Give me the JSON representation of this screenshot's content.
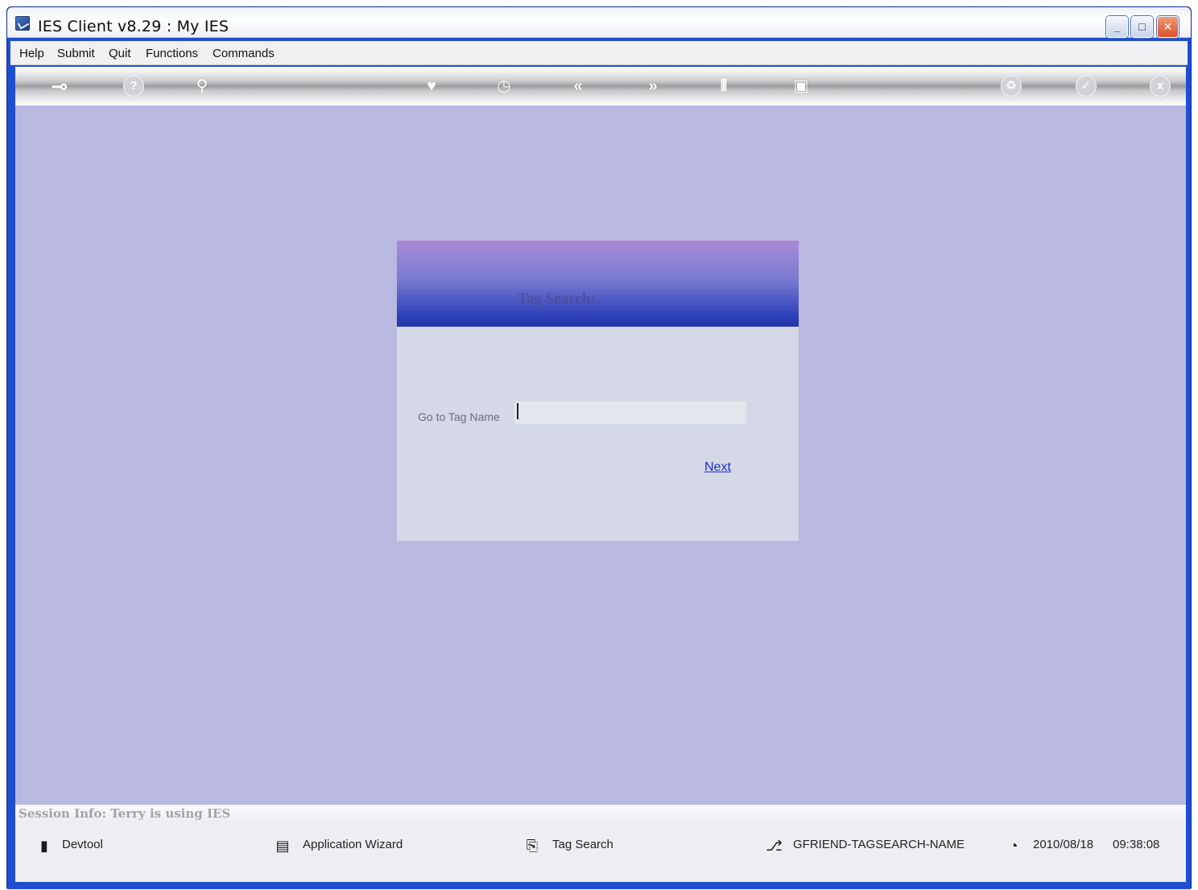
{
  "window": {
    "title": "IES Client v8.29 : My IES",
    "minimize_label": "_",
    "maximize_label": "□",
    "close_label": "✕"
  },
  "menu": {
    "items": [
      "Help",
      "Submit",
      "Quit",
      "Functions",
      "Commands"
    ]
  },
  "toolbar": {
    "icons": [
      "key-icon",
      "help-icon",
      "search-icon",
      "heart-icon",
      "clock-icon",
      "back-icon",
      "forward-icon",
      "tools-icon",
      "chip-icon",
      "recycle-icon",
      "check-icon",
      "close-icon"
    ],
    "glyphs": {
      "key": "⊸",
      "help": "?",
      "search": "⚲",
      "heart": "♥",
      "clock": "◷",
      "back": "«",
      "forward": "»",
      "tools": "⫴",
      "chip": "▣",
      "recycle": "♻",
      "check": "✓",
      "close": "x"
    }
  },
  "dialog": {
    "title": "Tag Search:",
    "field_label": "Go to Tag Name",
    "field_value": "",
    "next_label": "Next"
  },
  "session": {
    "info": "Session Info: Terry is using IES"
  },
  "status": {
    "devtool": "Devtool",
    "app_wizard": "Application Wizard",
    "tag_search": "Tag Search",
    "function_code": "GFRIEND-TAGSEARCH-NAME",
    "date": "2010/08/18",
    "time": "09:38:08"
  },
  "colors": {
    "background": "#b8b8e0",
    "dialog_header_top": "#a98ad6",
    "dialog_header_bottom": "#2436a8",
    "link": "#1a2fd0",
    "window_frame": "#1f4fd0"
  }
}
